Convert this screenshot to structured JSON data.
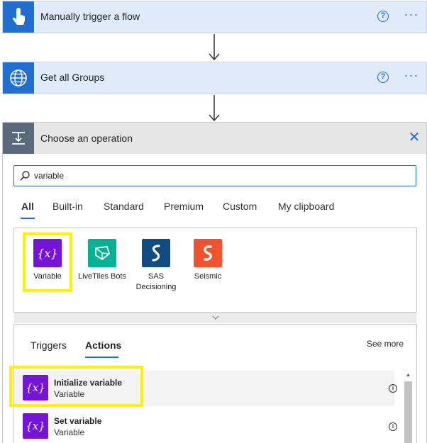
{
  "trigger": {
    "title": "Manually trigger a flow",
    "help": "?",
    "more": "···"
  },
  "http_step": {
    "title": "Get all Groups",
    "help": "?",
    "more": "···"
  },
  "operation": {
    "title": "Choose an operation",
    "close": "✕",
    "search": {
      "value": "variable",
      "placeholder": ""
    },
    "tabs": [
      "All",
      "Built-in",
      "Standard",
      "Premium",
      "Custom",
      "My clipboard"
    ],
    "connectors": [
      {
        "name": "Variable",
        "icon": "variable-icon",
        "color": "#7514d8"
      },
      {
        "name": "LiveTiles Bots",
        "icon": "livetiles-bots-icon",
        "color": "#00b294"
      },
      {
        "name": "SAS Decisioning",
        "icon": "sas-icon",
        "color": "#0f4c81"
      },
      {
        "name": "Seismic",
        "icon": "seismic-icon",
        "color": "#f2532c"
      }
    ],
    "subtabs": [
      "Triggers",
      "Actions"
    ],
    "see_more": "See more",
    "actions": [
      {
        "name": "Initialize variable",
        "connector": "Variable",
        "icon_text": "{x}"
      },
      {
        "name": "Set variable",
        "connector": "Variable",
        "icon_text": "{x}"
      }
    ]
  },
  "colors": {
    "accent": "#1f6fd1",
    "variable": "#7514d8",
    "highlight": "#fff200"
  }
}
